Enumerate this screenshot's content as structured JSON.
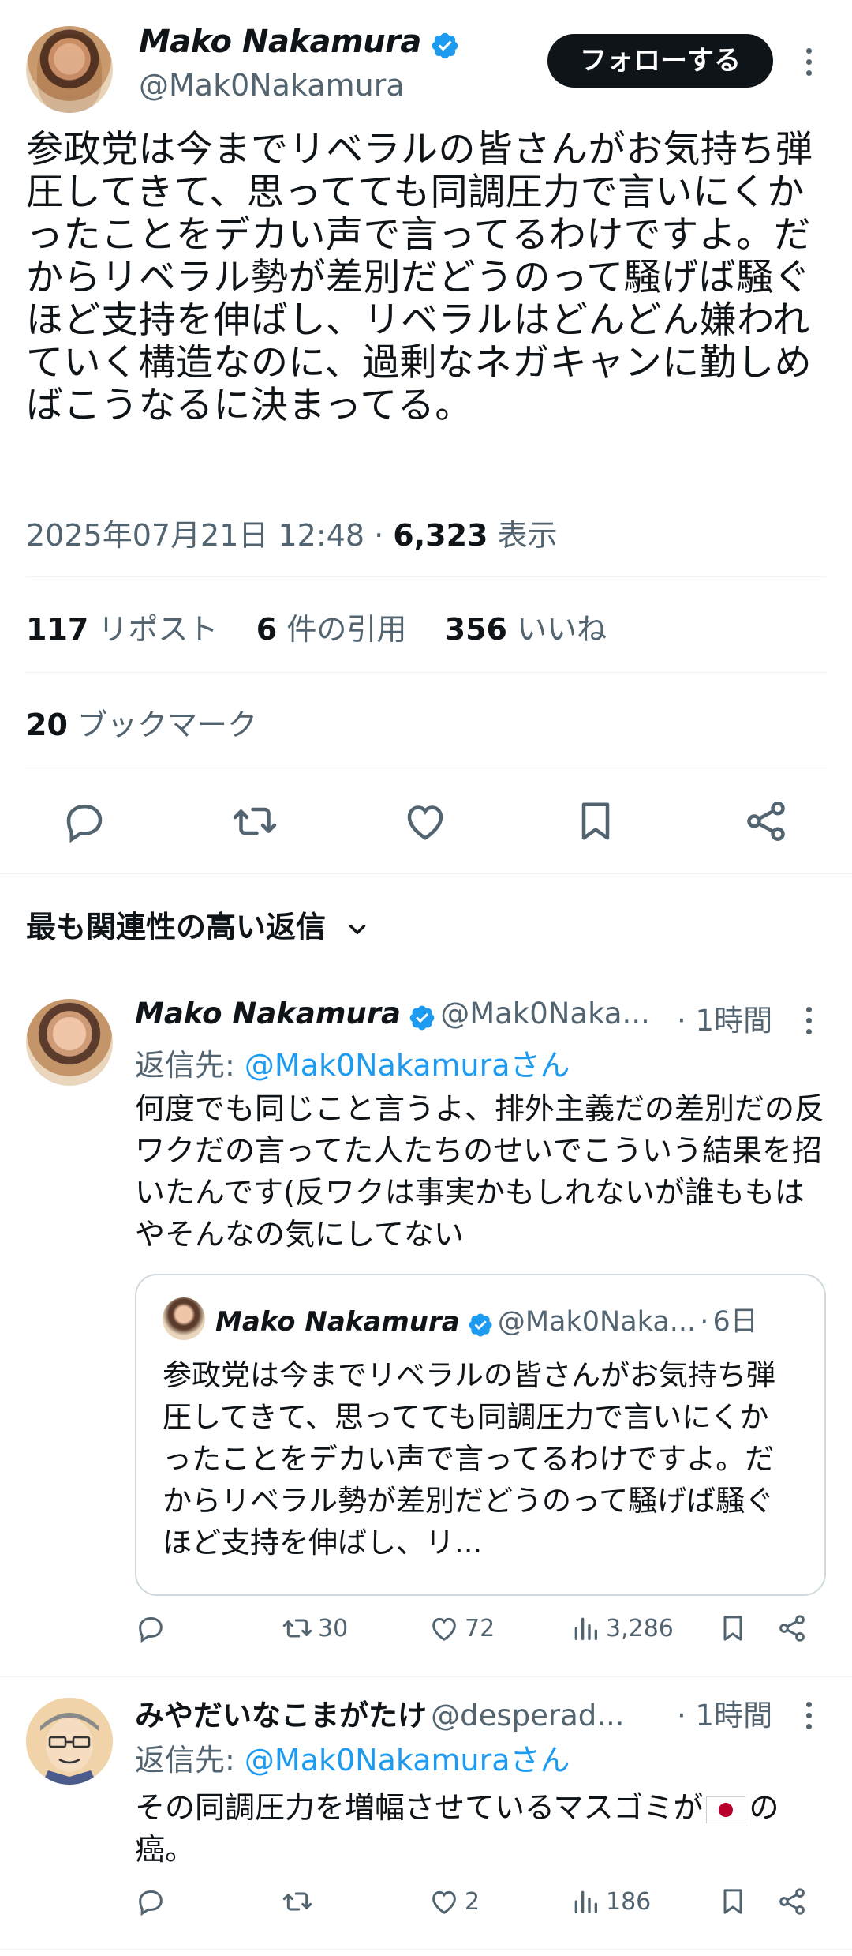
{
  "main_tweet": {
    "author_name": "Mako Nakamura",
    "author_handle": "@Mak0Nakamura",
    "follow_label": "フォローする",
    "text": "参政党は今までリベラルの皆さんがお気持ち弾圧してきて、思ってても同調圧力で言いにくかったことをデカい声で言ってるわけですよ。だからリベラル勢が差別だどうのって騒げば騒ぐほど支持を伸ばし、リベラルはどんどん嫌われていく構造なのに、過剰なネガキャンに勤しめばこうなるに決まってる。",
    "timestamp": "2025年07月21日 12:48",
    "views_count": "6,323",
    "views_label": "表示",
    "reposts_count": "117",
    "reposts_label": "リポスト",
    "quotes_count": "6",
    "quotes_label": "件の引用",
    "likes_count": "356",
    "likes_label": "いいね",
    "bookmarks_count": "20",
    "bookmarks_label": "ブックマーク"
  },
  "replies_section": {
    "title": "最も関連性の高い返信"
  },
  "replies": [
    {
      "author_name": "Mako Nakamura",
      "author_handle": "@Mak0Naka...",
      "time": "1時間",
      "reply_to_label": "返信先:",
      "reply_to_handle": "@Mak0Nakamuraさん",
      "text": "何度でも同じこと言うよ、排外主義だの差別だの反ワクだの言ってた人たちのせいでこういう結果を招いたんです(反ワクは事実かもしれないが誰ももはやそんなの気にしてない",
      "quote": {
        "author_name": "Mako Nakamura",
        "author_handle": "@Mak0Naka...",
        "time": "6日",
        "text": "参政党は今までリベラルの皆さんがお気持ち弾圧してきて、思ってても同調圧力で言いにくかったことをデカい声で言ってるわけですよ。だからリベラル勢が差別だどうのって騒げば騒ぐほど支持を伸ばし、リ..."
      },
      "reposts": "30",
      "likes": "72",
      "views": "3,286"
    },
    {
      "author_name": "みやだいなこまがたけ",
      "author_handle": "@desperad...",
      "time": "1時間",
      "reply_to_label": "返信先:",
      "reply_to_handle": "@Mak0Nakamuraさん",
      "text_before_flag": "その同調圧力を増幅させているマスゴミが",
      "text_after_flag": "の癌。",
      "reposts": "",
      "likes": "2",
      "views": "186"
    }
  ],
  "separator": "·",
  "icons": [
    "verified-badge-icon",
    "more-icon",
    "reply-icon",
    "repost-icon",
    "like-icon",
    "bookmark-icon",
    "share-icon",
    "views-icon",
    "chevron-down-icon",
    "japan-flag-icon"
  ],
  "colors": {
    "accent": "#1d9bf0",
    "text": "#0f1419",
    "muted": "#536471",
    "border": "#eff3f4"
  }
}
